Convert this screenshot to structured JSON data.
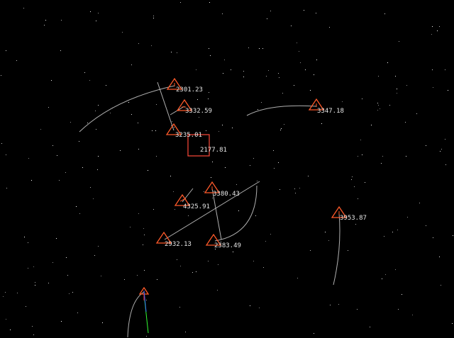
{
  "colors": {
    "background": "#000000",
    "marker": "#ff5a2a",
    "target_box": "#ff4a3a",
    "trail": "#cfcfcf",
    "label": "#e6e6e6",
    "axis_x": "#ff3333",
    "axis_y": "#33ff33",
    "axis_z": "#3366ff"
  },
  "contacts": [
    {
      "id": "c1",
      "shape": "triangle",
      "label": "2301.23"
    },
    {
      "id": "c2",
      "shape": "triangle",
      "label": "3332.59"
    },
    {
      "id": "c3",
      "shape": "triangle",
      "label": "3347.18"
    },
    {
      "id": "c4",
      "shape": "triangle",
      "label": "3235.01"
    },
    {
      "id": "c5",
      "shape": "square",
      "selected": true,
      "label": "2177.81"
    },
    {
      "id": "c6",
      "shape": "triangle",
      "label": "3380.43"
    },
    {
      "id": "c7",
      "shape": "triangle",
      "label": "4325.91"
    },
    {
      "id": "c8",
      "shape": "triangle",
      "label": "3953.87"
    },
    {
      "id": "c9",
      "shape": "triangle",
      "label": "2932.13"
    },
    {
      "id": "c10",
      "shape": "triangle",
      "label": "2383.49"
    },
    {
      "id": "player",
      "shape": "triangle-small",
      "label": ""
    }
  ],
  "player_axes": [
    "axis-x",
    "axis-y",
    "axis-z"
  ]
}
